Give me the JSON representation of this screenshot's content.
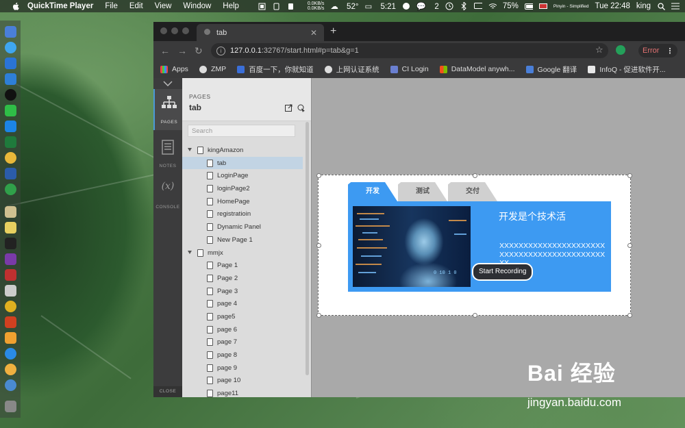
{
  "menubar": {
    "app_name": "QuickTime Player",
    "items": [
      "File",
      "Edit",
      "View",
      "Window",
      "Help"
    ],
    "status": {
      "net_up": "0.0KB/s",
      "net_down": "0.0KB/s",
      "temperature": "52°",
      "timer": "5:21",
      "wechat_count": "2",
      "battery": "75%",
      "input_method": "Pinyin - Simplified",
      "datetime": "Tue 22:48",
      "user": "king"
    }
  },
  "browser": {
    "tab_title": "tab",
    "url_host": "127.0.0.1",
    "url_rest": ":32767/start.html#p=tab&g=1",
    "error_label": "Error",
    "bookmarks": [
      "Apps",
      "ZMP",
      "百度一下，你就知道",
      "上网认证系统",
      "CI Login",
      "DataModel anywh...",
      "Google 翻译",
      "InfoQ - 促进软件开..."
    ]
  },
  "sidebar": {
    "pages_label": "PAGES",
    "notes_label": "NOTES",
    "console_label": "CONSOLE",
    "close_label": "CLOSE"
  },
  "pages_panel": {
    "caption": "PAGES",
    "title": "tab",
    "search_placeholder": "Search",
    "tree": [
      {
        "label": "kingAmazon",
        "level": 0,
        "folder": true
      },
      {
        "label": "tab",
        "level": 1,
        "selected": true
      },
      {
        "label": "LoginPage",
        "level": 1
      },
      {
        "label": "loginPage2",
        "level": 1
      },
      {
        "label": "HomePage",
        "level": 1
      },
      {
        "label": "registratioin",
        "level": 1
      },
      {
        "label": "Dynamic Panel",
        "level": 1
      },
      {
        "label": "New Page 1",
        "level": 1
      },
      {
        "label": "mmjx",
        "level": 0,
        "folder": true
      },
      {
        "label": "Page 1",
        "level": 1
      },
      {
        "label": "Page 2",
        "level": 1
      },
      {
        "label": "Page 3",
        "level": 1
      },
      {
        "label": "page 4",
        "level": 1
      },
      {
        "label": "page5",
        "level": 1
      },
      {
        "label": "page 6",
        "level": 1
      },
      {
        "label": "page 7",
        "level": 1
      },
      {
        "label": "page 8",
        "level": 1
      },
      {
        "label": "page 9",
        "level": 1
      },
      {
        "label": "page 10",
        "level": 1
      },
      {
        "label": "page11",
        "level": 1
      }
    ]
  },
  "prototype": {
    "tabs": [
      "开发",
      "测试",
      "交付"
    ],
    "active_tab": 0,
    "panel_title": "开发是个技术活",
    "panel_text": "XXXXXXXXXXXXXXXXXXXXXXXXXXXXXXXXXXXXXXXXXXXXXX",
    "binary_text": "0 10 1 0",
    "record_button": "Start Recording",
    "accent": "#3d9af2"
  },
  "watermark": {
    "brand": "Bai 经验",
    "site": "jingyan.baidu.com"
  }
}
